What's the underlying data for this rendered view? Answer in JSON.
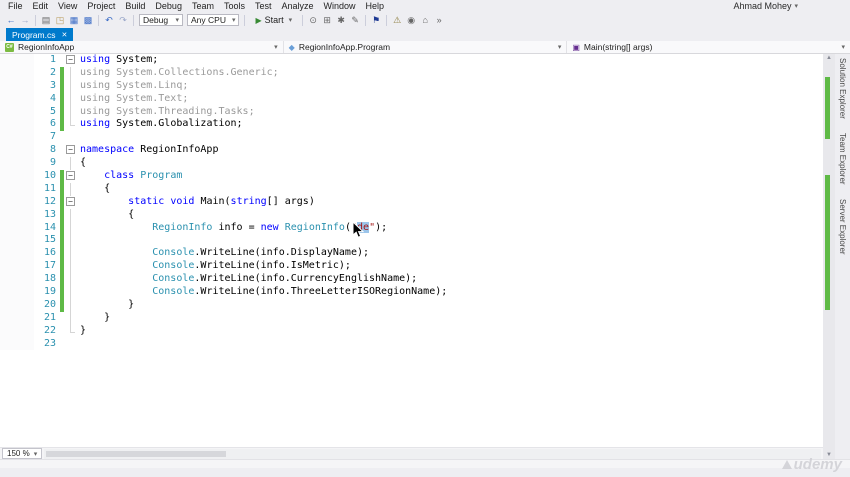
{
  "window": {
    "user": "Ahmad Mohey"
  },
  "menu": {
    "items": [
      "File",
      "Edit",
      "View",
      "Project",
      "Build",
      "Debug",
      "Team",
      "Tools",
      "Test",
      "Analyze",
      "Window",
      "Help"
    ]
  },
  "toolbar": {
    "icon_groups_left": [
      [
        "navigate-back",
        "navigate-forward"
      ],
      [
        "new-file",
        "open-file",
        "save",
        "save-all"
      ],
      [
        "undo",
        "redo"
      ]
    ],
    "config_dropdown": "Debug",
    "platform_dropdown": "Any CPU",
    "start_button": "Start",
    "icon_groups_right": [
      [
        "find-in-files",
        "solution-explorer",
        "properties-window",
        "toolbox"
      ],
      [
        "feedback-flag"
      ],
      [
        "error-list",
        "object-browser",
        "start-page",
        "toolbar-options"
      ]
    ]
  },
  "tabs": {
    "active": "Program.cs",
    "close": "✕"
  },
  "navbar": {
    "project": "RegionInfoApp",
    "type": "RegionInfoApp.Program",
    "member": "Main(string[] args)"
  },
  "editor": {
    "zoom": "150 %",
    "caret_line": 14,
    "lines": [
      {
        "n": 1,
        "c": false,
        "f": "box",
        "t": [
          [
            "k",
            "using"
          ],
          [
            "p",
            " System;"
          ]
        ]
      },
      {
        "n": 2,
        "c": true,
        "f": "line",
        "t": [
          [
            "g",
            "using System.Collections.Generic;"
          ]
        ]
      },
      {
        "n": 3,
        "c": true,
        "f": "line",
        "t": [
          [
            "g",
            "using System.Linq;"
          ]
        ]
      },
      {
        "n": 4,
        "c": true,
        "f": "line",
        "t": [
          [
            "g",
            "using System.Text;"
          ]
        ]
      },
      {
        "n": 5,
        "c": true,
        "f": "line",
        "t": [
          [
            "g",
            "using System.Threading.Tasks;"
          ]
        ]
      },
      {
        "n": 6,
        "c": true,
        "f": "end",
        "t": [
          [
            "k",
            "using"
          ],
          [
            "p",
            " System.Globalization;"
          ]
        ]
      },
      {
        "n": 7,
        "c": false,
        "f": "",
        "t": []
      },
      {
        "n": 8,
        "c": false,
        "f": "box",
        "t": [
          [
            "k",
            "namespace"
          ],
          [
            "p",
            " RegionInfoApp"
          ]
        ]
      },
      {
        "n": 9,
        "c": false,
        "f": "line",
        "t": [
          [
            "p",
            "{"
          ]
        ]
      },
      {
        "n": 10,
        "c": true,
        "f": "box",
        "t": [
          [
            "p",
            "    "
          ],
          [
            "k",
            "class"
          ],
          [
            "p",
            " "
          ],
          [
            "t",
            "Program"
          ]
        ]
      },
      {
        "n": 11,
        "c": true,
        "f": "line",
        "t": [
          [
            "p",
            "    {"
          ]
        ]
      },
      {
        "n": 12,
        "c": true,
        "f": "box",
        "t": [
          [
            "p",
            "        "
          ],
          [
            "k",
            "static"
          ],
          [
            "p",
            " "
          ],
          [
            "k",
            "void"
          ],
          [
            "p",
            " Main("
          ],
          [
            "k",
            "string"
          ],
          [
            "p",
            "[] args)"
          ]
        ]
      },
      {
        "n": 13,
        "c": true,
        "f": "line",
        "t": [
          [
            "p",
            "        {"
          ]
        ]
      },
      {
        "n": 14,
        "c": true,
        "f": "line",
        "t": [
          [
            "p",
            "            "
          ],
          [
            "t",
            "RegionInfo"
          ],
          [
            "p",
            " info = "
          ],
          [
            "k",
            "new"
          ],
          [
            "p",
            " "
          ],
          [
            "t",
            "RegionInfo"
          ],
          [
            "p",
            "("
          ],
          [
            "s",
            "\""
          ],
          [
            "h",
            "de"
          ],
          [
            "s",
            "\""
          ],
          [
            "p",
            ");"
          ]
        ]
      },
      {
        "n": 15,
        "c": true,
        "f": "line",
        "t": []
      },
      {
        "n": 16,
        "c": true,
        "f": "line",
        "t": [
          [
            "p",
            "            "
          ],
          [
            "t",
            "Console"
          ],
          [
            "p",
            ".WriteLine(info.DisplayName);"
          ]
        ]
      },
      {
        "n": 17,
        "c": true,
        "f": "line",
        "t": [
          [
            "p",
            "            "
          ],
          [
            "t",
            "Console"
          ],
          [
            "p",
            ".WriteLine(info.IsMetric);"
          ]
        ]
      },
      {
        "n": 18,
        "c": true,
        "f": "line",
        "t": [
          [
            "p",
            "            "
          ],
          [
            "t",
            "Console"
          ],
          [
            "p",
            ".WriteLine(info.CurrencyEnglishName);"
          ]
        ]
      },
      {
        "n": 19,
        "c": true,
        "f": "line",
        "t": [
          [
            "p",
            "            "
          ],
          [
            "t",
            "Console"
          ],
          [
            "p",
            ".WriteLine(info.ThreeLetterISORegionName);"
          ]
        ]
      },
      {
        "n": 20,
        "c": true,
        "f": "line",
        "t": [
          [
            "p",
            "        }"
          ]
        ]
      },
      {
        "n": 21,
        "c": false,
        "f": "line",
        "t": [
          [
            "p",
            "    }"
          ]
        ]
      },
      {
        "n": 22,
        "c": false,
        "f": "end",
        "t": [
          [
            "p",
            "}"
          ]
        ]
      },
      {
        "n": 23,
        "c": false,
        "f": "",
        "t": []
      }
    ]
  },
  "right_panel": {
    "tabs": [
      "Solution Explorer",
      "Team Explorer",
      "Server Explorer"
    ]
  },
  "watermark": "udemy",
  "colors": {
    "active_tab": "#007acc",
    "keyword": "#0000ff",
    "type": "#2b91af",
    "string": "#a31515",
    "inactive_using": "#9a9a9a",
    "change_bar": "#5fba46",
    "line_number": "#2b91af",
    "start_arrow": "#388a34"
  }
}
